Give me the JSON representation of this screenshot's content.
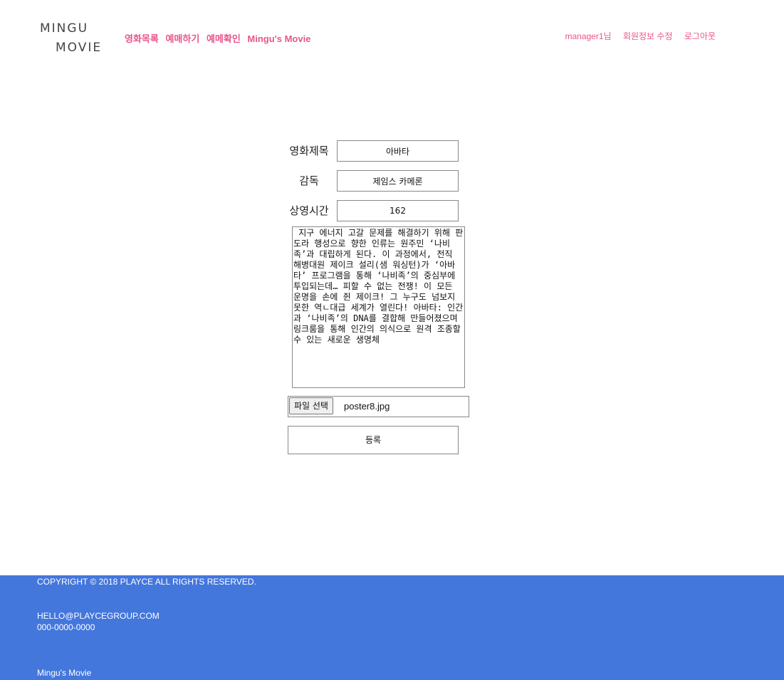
{
  "header": {
    "logo_line1": "MINGU",
    "logo_line2": "MOVIE",
    "nav": [
      "영화목록",
      "예매하기",
      "예메확인",
      "Mingu's Movie"
    ],
    "user_name": "manager1님",
    "edit_profile": "회원정보 수정",
    "logout": "로그아웃"
  },
  "form": {
    "title_label": "영화제목",
    "title_value": "아바타",
    "director_label": "감독",
    "director_value": "제임스 카메론",
    "runtime_label": "상영시간",
    "runtime_value": "162",
    "description": " 지구 에너지 고갈 문제를 해결하기 위해 판도라 행성으로 향한 인류는 원주민 ‘나비족’과 대립하게 된다. 이 과정에서, 전직 해병대원 제이크 설리(샘 워싱턴)가 ‘아바타’ 프로그램을 통해 ‘나비족’의 중심부에 투입되는데… 피할 수 없는 전쟁! 이 모든 운명을 손에 쥔 제이크! 그 누구도 넘보지 못한 역ㄴ대급 세계가 열린다! 아바타: 인간과 ‘나비족’의 DNA를 결합해 만들어졌으며 링크룸을 통해 인간의 의식으로 원격 조종할 수 있는 새로운 생명체",
    "file_button": "파일 선택",
    "file_name": "poster8.jpg",
    "submit": "등록"
  },
  "footer": {
    "copyright": "COPYRIGHT © 2018 PLAYCE ALL RIGHTS RESERVED.",
    "email": "HELLO@PLAYCEGROUP.COM",
    "phone": "000-0000-0000",
    "site_name": "Mingu's Movie"
  },
  "colors": {
    "accent": "#e9558c",
    "footer_bg": "#4477dc"
  }
}
